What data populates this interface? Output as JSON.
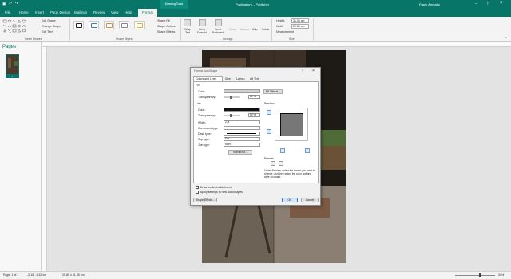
{
  "titlebar": {
    "title": "Publication1 - Publisher",
    "context_tab": "Drawing Tools",
    "user": "Frank Amoako",
    "colors": {
      "accent": "#077568"
    }
  },
  "tabs": [
    {
      "label": "File"
    },
    {
      "label": "Home"
    },
    {
      "label": "Insert"
    },
    {
      "label": "Page Design"
    },
    {
      "label": "Mailings"
    },
    {
      "label": "Review"
    },
    {
      "label": "View"
    },
    {
      "label": "Help"
    },
    {
      "label": "Format"
    }
  ],
  "ribbon": {
    "insert_shapes": {
      "edit_shape": "Edit Shape",
      "change_shape": "Change Shape",
      "edit_text": "Edit Text",
      "group_label": "Insert Shapes"
    },
    "shape_styles": {
      "group_label": "Shape Styles",
      "fill": "Shape Fill",
      "outline": "Shape Outline",
      "effects": "Shape Effects"
    },
    "arrange": {
      "group_label": "Arrange",
      "wrap_text": "Wrap Text",
      "bring_forward": "Bring Forward",
      "send_backward": "Send Backward",
      "group": "Group",
      "ungroup": "Ungroup",
      "align": "Align",
      "rotate": "Rotate"
    },
    "size": {
      "group_label": "Size",
      "height_label": "Height",
      "height_value": "31.35 cm",
      "width_label": "Width",
      "width_value": "20.85 cm",
      "measurement": "Measurement"
    }
  },
  "pages_pane": {
    "title": "Pages",
    "page_number": "1"
  },
  "statusbar": {
    "page": "Page: 1 of 1",
    "position": "-2.15, -1.32 cm",
    "size": "20.85 x 31.35 cm",
    "zoom": "34%"
  },
  "dialog": {
    "title": "Format AutoShape",
    "help": "?",
    "close": "×",
    "tabs": [
      "Colors and Lines",
      "Size",
      "Layout",
      "Alt Text"
    ],
    "fill": {
      "section": "Fill",
      "color_label": "Color:",
      "transparency_label": "Transparency:",
      "transparency_value": "50 %",
      "fill_effects": "Fill Effects..."
    },
    "line": {
      "section": "Line",
      "color_label": "Color:",
      "transparency_label": "Transparency:",
      "transparency_value": "50 %",
      "width_label": "Width:",
      "width_value": "2 pt",
      "compound_label": "Compound type:",
      "dash_label": "Dash type:",
      "cap_label": "Cap type:",
      "cap_value": "Flat",
      "join_label": "Join type:",
      "join_value": "Miter",
      "borderart": "BorderArt..."
    },
    "preview": {
      "label": "Preview",
      "presets_label": "Presets",
      "instructions": "Under Preview, select the border you want to change, and then select the color and line style you want."
    },
    "checkbox_draw_inside": "Draw border inside frame",
    "checkbox_apply_new": "Apply settings to new AutoShapes",
    "shape_effects_btn": "Shape Effects...",
    "ok": "OK",
    "cancel": "Cancel"
  }
}
